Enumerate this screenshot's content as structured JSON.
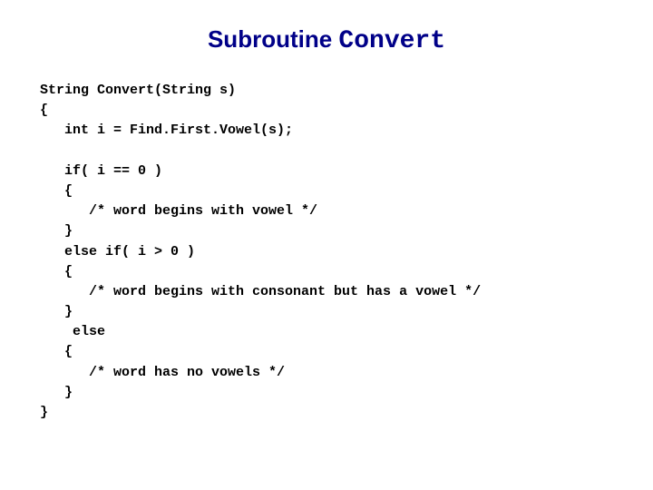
{
  "title": {
    "prefix": "Subroutine ",
    "mono": "Convert"
  },
  "code": {
    "l01": "String Convert(String s)",
    "l02": "{",
    "l03": "   int i = Find.First.Vowel(s);",
    "l04": "",
    "l05": "   if( i == 0 )",
    "l06": "   {",
    "l07": "      /* word begins with vowel */",
    "l08": "   }",
    "l09": "   else if( i > 0 )",
    "l10": "   {",
    "l11": "      /* word begins with consonant but has a vowel */",
    "l12": "   }",
    "l13": "    else",
    "l14": "   {",
    "l15": "      /* word has no vowels */",
    "l16": "   }",
    "l17": "}"
  }
}
